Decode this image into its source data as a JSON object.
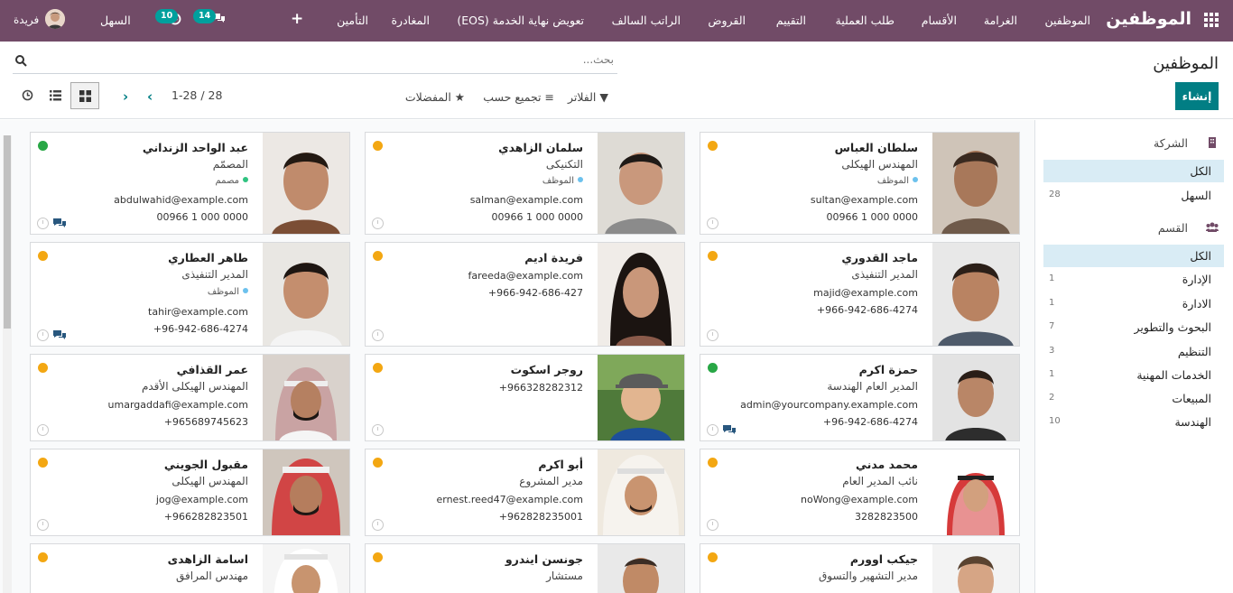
{
  "navbar": {
    "brand": "الموظفين",
    "menu": [
      "الموظفين",
      "الغرامة",
      "الأقسام",
      "طلب العملية",
      "التقييم",
      "القروض",
      "الراتب السالف",
      "تعويض نهاية الخدمة (EOS)",
      "المغادرة",
      "التأمين"
    ],
    "company": "السهل",
    "chat_badge": "14",
    "activity_badge": "10",
    "user_name": "فريدة",
    "color": "#714b67"
  },
  "control": {
    "title": "الموظفين",
    "create_label": "إنشاء",
    "search_placeholder": "بحث...",
    "filters_label": "الفلاتر",
    "group_by_label": "تجميع حسب",
    "favorites_label": "المفضلات",
    "pager_text": "1-28 / 28",
    "accent": "#017e84"
  },
  "side": {
    "company_header": "الشركة",
    "companies": [
      {
        "label": "الكل",
        "count": ""
      },
      {
        "label": "السهل",
        "count": "28"
      }
    ],
    "department_header": "القسم",
    "departments": [
      {
        "label": "الكل",
        "count": ""
      },
      {
        "label": "الإدارة",
        "count": "1"
      },
      {
        "label": "الادارة",
        "count": "1"
      },
      {
        "label": "البحوث والتطوير",
        "count": "7"
      },
      {
        "label": "التنظيم",
        "count": "3"
      },
      {
        "label": "الخدمات المهنية",
        "count": "1"
      },
      {
        "label": "المبيعات",
        "count": "2"
      },
      {
        "label": "الهندسة",
        "count": "10"
      }
    ]
  },
  "employees": [
    {
      "name": "سلطان العباس",
      "job": "المهندس الهيكلى",
      "tag": "الموظف",
      "email": "sultan@example.com",
      "phone": "00966 1 000 0000",
      "status": "orange"
    },
    {
      "name": "سلمان الزاهدي",
      "job": "التكنيكى",
      "tag": "الموظف",
      "email": "salman@example.com",
      "phone": "00966 1 000 0000",
      "status": "orange"
    },
    {
      "name": "عبد الواحد الزنداني",
      "job": "المصمّم",
      "tag": "مصمم",
      "email": "abdulwahid@example.com",
      "phone": "00966 1 000 0000",
      "status": "green"
    },
    {
      "name": "ماجد القدوري",
      "job": "المدير التنفيذى",
      "tag": "",
      "email": "majid@example.com",
      "phone": "+966-942-686-4274",
      "status": "orange"
    },
    {
      "name": "فريدة اديم",
      "job": "",
      "tag": "",
      "email": "fareeda@example.com",
      "phone": "+966-942-686-427",
      "status": "orange"
    },
    {
      "name": "طاهر العطاري",
      "job": "المدير التنفيذى",
      "tag": "الموظف",
      "email": "tahir@example.com",
      "phone": "+96-942-686-4274",
      "status": "orange"
    },
    {
      "name": "حمزة اكرم",
      "job": "المدير العام الهندسة",
      "tag": "",
      "email": "admin@yourcompany.example.com",
      "phone": "+96-942-686-4274",
      "status": "green"
    },
    {
      "name": "روجر اسكوت",
      "job": "",
      "tag": "",
      "email": "",
      "phone": "+966328282312",
      "status": "orange"
    },
    {
      "name": "عمر القذافي",
      "job": "المهندس الهيكلى الأقدم",
      "tag": "",
      "email": "umargaddafi@example.com",
      "phone": "+965689745623",
      "status": "orange"
    },
    {
      "name": "محمد مدني",
      "job": "نائب المدير العام",
      "tag": "",
      "email": "noWong@example.com",
      "phone": "3282823500",
      "status": "orange"
    },
    {
      "name": "أبو اكرم",
      "job": "مدير المشروع",
      "tag": "",
      "email": "ernest.reed47@example.com",
      "phone": "+962828235001",
      "status": "orange"
    },
    {
      "name": "مقبول الجويني",
      "job": "المهندس الهيكلى",
      "tag": "",
      "email": "jog@example.com",
      "phone": "+966282823501",
      "status": "orange"
    },
    {
      "name": "جيكب اوورم",
      "job": "مدير التشهير والتسوق",
      "tag": "",
      "email": "",
      "phone": "",
      "status": "orange"
    },
    {
      "name": "جونسن ايندرو",
      "job": "مستشار",
      "tag": "",
      "email": "",
      "phone": "",
      "status": "orange"
    },
    {
      "name": "اسامة الزاهدى",
      "job": "مهندس المرافق",
      "tag": "",
      "email": "",
      "phone": "",
      "status": "orange"
    }
  ]
}
